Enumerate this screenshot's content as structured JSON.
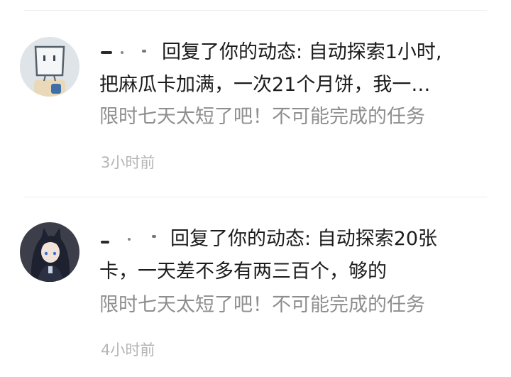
{
  "notifications": [
    {
      "avatar_icon": "boxhead-character-avatar-icon",
      "action": "回复了你的动态:",
      "reply_line1": "自动探索1小时,",
      "reply_line2": "把麻瓜卡加满，一次21个月饼，我一…",
      "quoted_post": "限时七天太短了吧！不可能完成的任务",
      "time": "3小时前"
    },
    {
      "avatar_icon": "anime-girl-avatar-icon",
      "action": "回复了你的动态:",
      "reply_line1": "自动探索20张",
      "reply_line2": "卡，一天差不多有两三百个，够的",
      "quoted_post": "限时七天太短了吧！不可能完成的任务",
      "time": "4小时前"
    }
  ],
  "colors": {
    "primary_text": "#1c1c1c",
    "quote_text": "#8e8e8e",
    "time_text": "#b5b5b5",
    "divider": "#ececec"
  }
}
